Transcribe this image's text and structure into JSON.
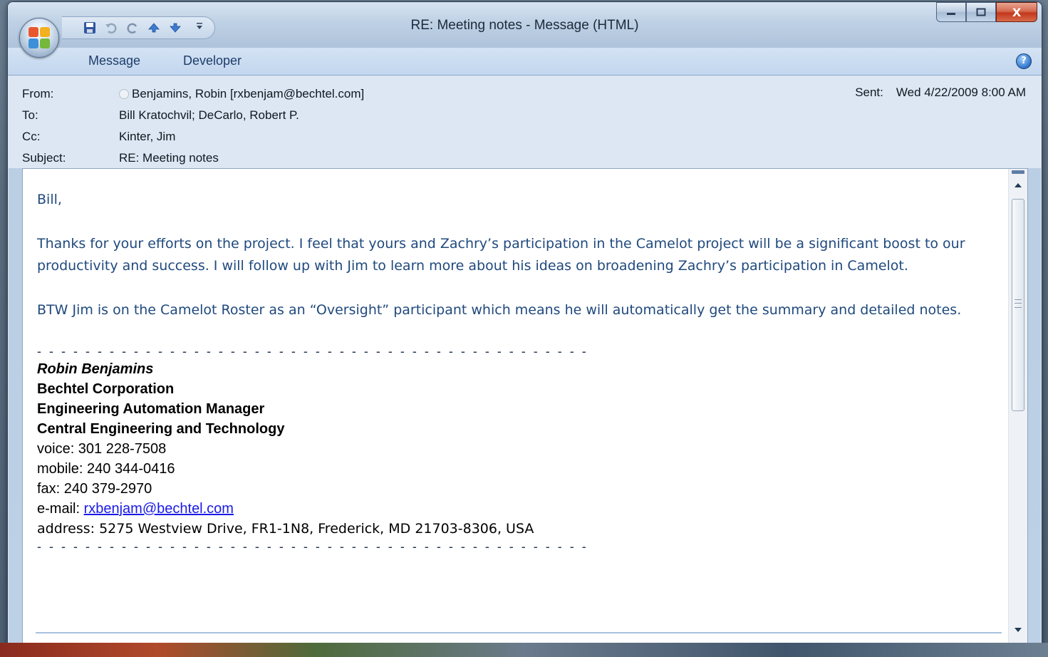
{
  "window": {
    "title": "RE: Meeting notes - Message (HTML)"
  },
  "quick_access": {
    "items": [
      {
        "name": "save-icon",
        "glyph": "💾"
      },
      {
        "name": "undo-icon",
        "glyph": "↶"
      },
      {
        "name": "redo-icon",
        "glyph": "↷"
      },
      {
        "name": "previous-item-icon",
        "glyph": "▲"
      },
      {
        "name": "next-item-icon",
        "glyph": "▼"
      }
    ],
    "customize_glyph": "⯆"
  },
  "window_controls": {
    "minimize": "▁",
    "maximize": "□",
    "close": "X"
  },
  "ribbon": {
    "tabs": [
      "Message",
      "Developer"
    ],
    "help_glyph": "?"
  },
  "header": {
    "from_label": "From:",
    "from_value": "Benjamins, Robin [rxbenjam@bechtel.com]",
    "to_label": "To:",
    "to_value": "Bill Kratochvil; DeCarlo, Robert P.",
    "cc_label": "Cc:",
    "cc_value": "Kinter, Jim",
    "subject_label": "Subject:",
    "subject_value": "RE: Meeting notes",
    "sent_label": "Sent:",
    "sent_value": "Wed 4/22/2009 8:00 AM"
  },
  "body": {
    "greeting": "Bill,",
    "paragraph1": "Thanks for your efforts on the project.  I feel that yours and Zachry’s participation in the Camelot project will be a significant boost to our productivity and success.  I will follow up with Jim to learn more about his ideas on broadening Zachry’s participation in Camelot.",
    "paragraph2": "BTW Jim is on the Camelot Roster as an “Oversight” participant which means he will automatically get the summary and detailed notes.",
    "dashes": "- - - - - - - - - - - - - - - - - - - - - - - - - - - - - - - - - - - - - - - - - - - - - - - - - - - - - - - -"
  },
  "signature": {
    "name": "Robin Benjamins",
    "company": "Bechtel Corporation",
    "role": "Engineering Automation Manager",
    "department": "Central Engineering and Technology",
    "voice": "voice: 301 228-7508",
    "mobile": "mobile: 240 344-0416",
    "fax": "fax: 240 379-2970",
    "email_label": "e-mail: ",
    "email": "rxbenjam@bechtel.com",
    "address": "address: 5275 Westview Drive, FR1-1N8, Frederick, MD 21703-8306, USA"
  },
  "colors": {
    "body_text": "#1f497d",
    "link": "#1a1ae6",
    "close_button": "#c2381c"
  }
}
